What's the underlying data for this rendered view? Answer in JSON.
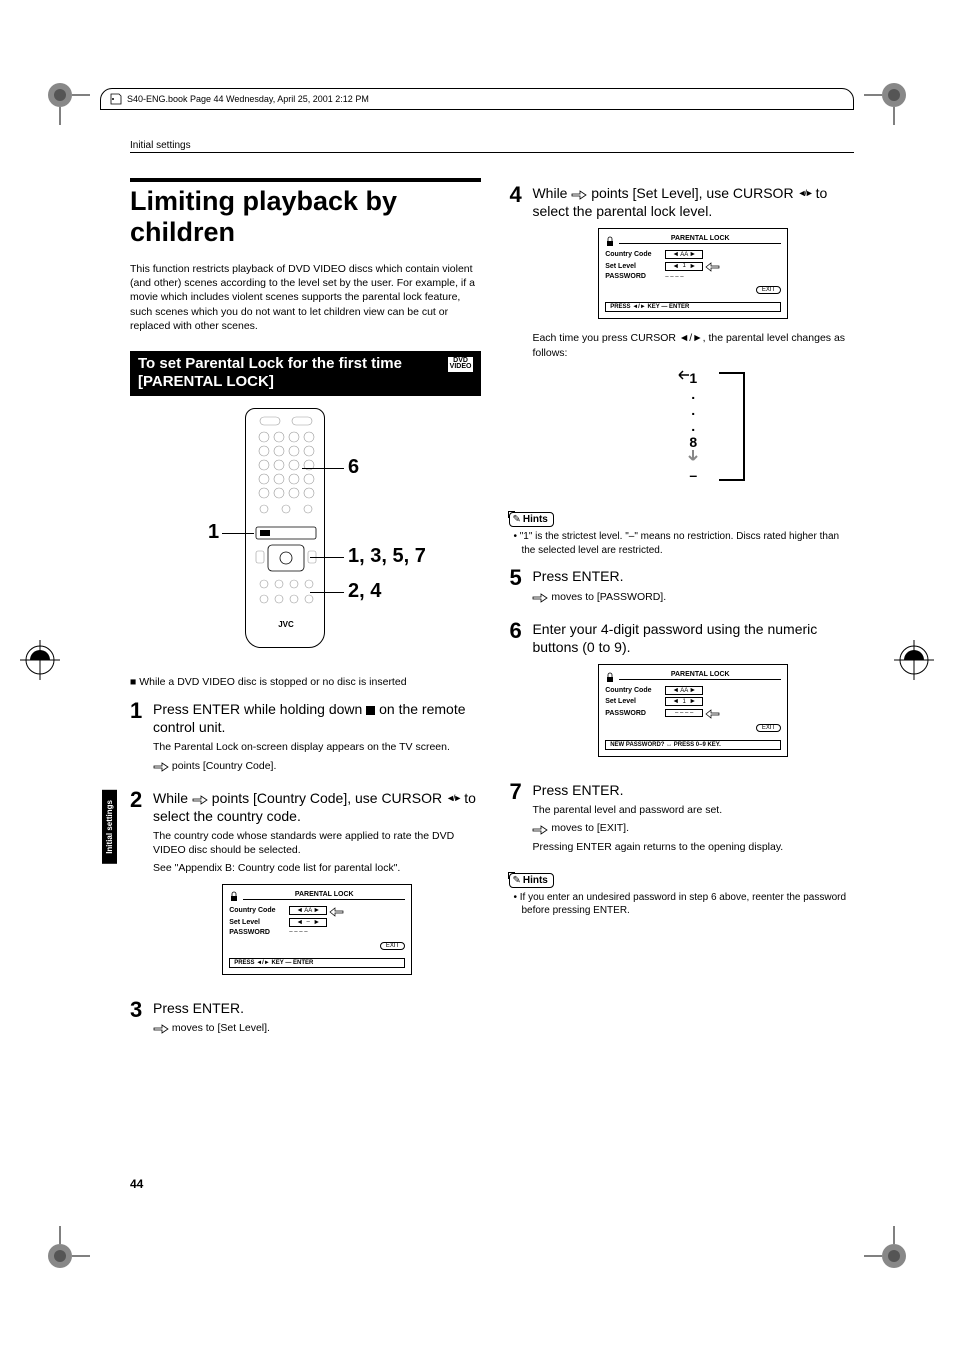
{
  "book_header": "S40-ENG.book  Page 44  Wednesday, April 25, 2001  2:12 PM",
  "breadcrumb": "Initial settings",
  "side_tab": "Initial settings",
  "page_number": "44",
  "title": "Limiting playback by children",
  "intro": "This function restricts playback of DVD VIDEO discs which contain violent (and other) scenes according to the level set by the user. For example, if a movie which includes violent scenes supports the parental lock feature, such scenes which you do not want to let children view can be cut or replaced with other scenes.",
  "section": {
    "title": "To set Parental Lock for the first time [PARENTAL LOCK]",
    "badge_top": "DVD",
    "badge_bottom": "VIDEO"
  },
  "callouts": {
    "c1": "1",
    "c6": "6",
    "c1357": "1, 3, 5, 7",
    "c24": "2, 4"
  },
  "remote_brand": "JVC",
  "precondition": "■ While a DVD VIDEO disc is stopped or no disc is inserted",
  "steps": {
    "s1": {
      "num": "1",
      "head_a": "Press ENTER while holding down ",
      "head_b": " on the remote control unit.",
      "sub1": "The Parental Lock on-screen display appears on the TV screen.",
      "sub2": " points [Country Code]."
    },
    "s2": {
      "num": "2",
      "head_a": "While ",
      "head_b": " points [Country Code], use CURSOR ",
      "head_c": " to select the country code.",
      "sub1": "The country code whose standards were applied to rate the DVD VIDEO disc should be selected.",
      "sub2": "See \"Appendix B: Country code list for parental lock\"."
    },
    "s3": {
      "num": "3",
      "head": "Press ENTER.",
      "sub": " moves to [Set Level]."
    },
    "s4": {
      "num": "4",
      "head_a": "While ",
      "head_b": " points [Set Level], use CURSOR ",
      "head_c": " to select the parental lock level.",
      "sub": "Each time you press  CURSOR ◄/►, the parental level changes as follows:"
    },
    "s5": {
      "num": "5",
      "head": "Press ENTER.",
      "sub": " moves to [PASSWORD]."
    },
    "s6": {
      "num": "6",
      "head": "Enter your 4-digit password using the numeric buttons (0 to 9)."
    },
    "s7": {
      "num": "7",
      "head": "Press ENTER.",
      "sub1": "The parental level and password are set.",
      "sub2": " moves to [EXIT].",
      "sub3": "Pressing ENTER again returns to the opening display."
    }
  },
  "osd": {
    "title": "PARENTAL LOCK",
    "country_label": "Country Code",
    "country_val": "AA",
    "level_label": "Set Level",
    "level_val_dash": "–",
    "level_val_1": "1",
    "pass_label": "PASSWORD",
    "pass_val": "– – – –",
    "exit": "EXIT",
    "footer1": "PRESS ◄/► KEY — ENTER",
    "footer2": "NEW PASSWORD? ↔ PRESS 0–9 KEY."
  },
  "cycle": {
    "top": "1",
    "dots": ".",
    "eight": "8",
    "dash": "–"
  },
  "hints_label": "Hints",
  "hint1": "• \"1\" is the strictest level. \"–\" means no restriction. Discs rated higher than the selected level are restricted.",
  "hint2": "• If you enter an undesired password in step 6 above, reenter the password before pressing ENTER."
}
